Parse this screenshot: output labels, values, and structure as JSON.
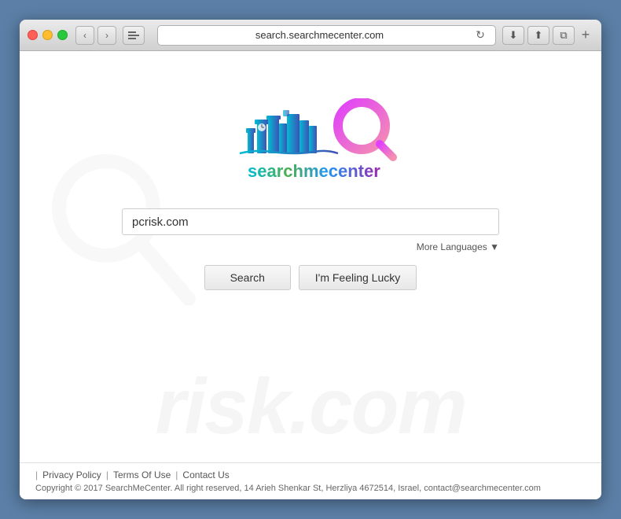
{
  "browser": {
    "url": "search.searchmecenter.com",
    "traffic_lights": {
      "red": "close",
      "yellow": "minimize",
      "green": "maximize"
    }
  },
  "page": {
    "logo": {
      "brand": "searchmecenter",
      "brand_search": "search",
      "brand_me": "me",
      "brand_center": "center"
    },
    "search": {
      "input_value": "pcrisk.com",
      "more_languages": "More Languages ▼",
      "button_search": "Search",
      "button_lucky": "I'm Feeling Lucky"
    },
    "footer": {
      "privacy_label": "Privacy Policy",
      "terms_label": "Terms Of Use",
      "contact_label": "Contact Us",
      "copyright": "Copyright © 2017 SearchMeCenter. All right reserved, 14 Arieh Shenkar St, Herzliya 4672514, Israel, contact@searchmecenter.com"
    }
  }
}
